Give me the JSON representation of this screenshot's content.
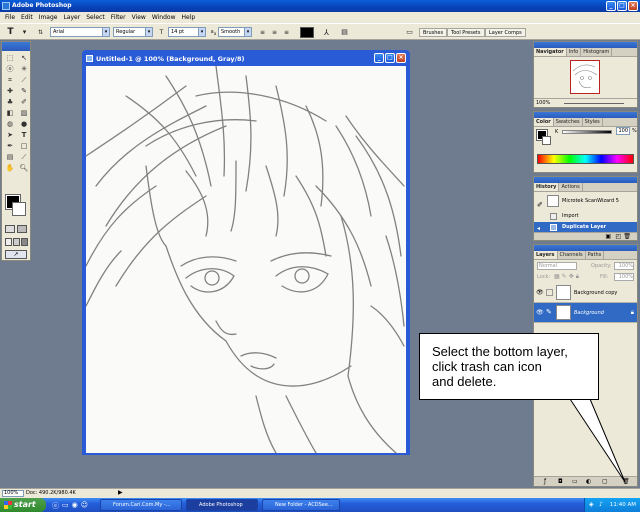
{
  "app": {
    "title": "Adobe Photoshop"
  },
  "menu": [
    "File",
    "Edit",
    "Image",
    "Layer",
    "Select",
    "Filter",
    "View",
    "Window",
    "Help"
  ],
  "options": {
    "font_family": "Arial",
    "font_style": "Regular",
    "font_size": "14 pt",
    "antialias": "Smooth",
    "text_color": "#000000"
  },
  "wells": [
    "Brushes",
    "Tool Presets",
    "Layer Comps"
  ],
  "document": {
    "title": "Untitled-1 @ 100% (Background, Gray/8)"
  },
  "navigator": {
    "tabs": [
      "Navigator",
      "Info",
      "Histogram"
    ],
    "zoom": "100%"
  },
  "color_panel": {
    "tabs": [
      "Color",
      "Swatches",
      "Styles"
    ],
    "k_label": "K",
    "k_value": "100",
    "percent": "%"
  },
  "history": {
    "tabs": [
      "History",
      "Actions"
    ],
    "items": [
      {
        "label": "Microtek ScanWizard 5"
      },
      {
        "label": "Import"
      },
      {
        "label": "Duplicate Layer"
      }
    ],
    "selected": "Duplicate Layer"
  },
  "layers": {
    "tabs": [
      "Layers",
      "Channels",
      "Paths"
    ],
    "blend_mode": "Normal",
    "opacity_label": "Opacity:",
    "opacity": "100%",
    "lock_label": "Lock:",
    "fill_label": "Fill:",
    "fill": "100%",
    "rows": [
      {
        "name": "Background copy"
      },
      {
        "name": "Background"
      }
    ],
    "selected": "Background"
  },
  "callout": {
    "text": "Select the bottom layer,\nclick trash can icon\nand delete."
  },
  "status": {
    "zoom": "100%",
    "doc": "Doc: 490.2K/980.4K"
  },
  "taskbar": {
    "start": "start",
    "buttons": [
      "Forum.Cari.Com.My -...",
      "Adobe Photoshop",
      "New Folder - ACDSee..."
    ],
    "clock": "11:40 AM"
  }
}
